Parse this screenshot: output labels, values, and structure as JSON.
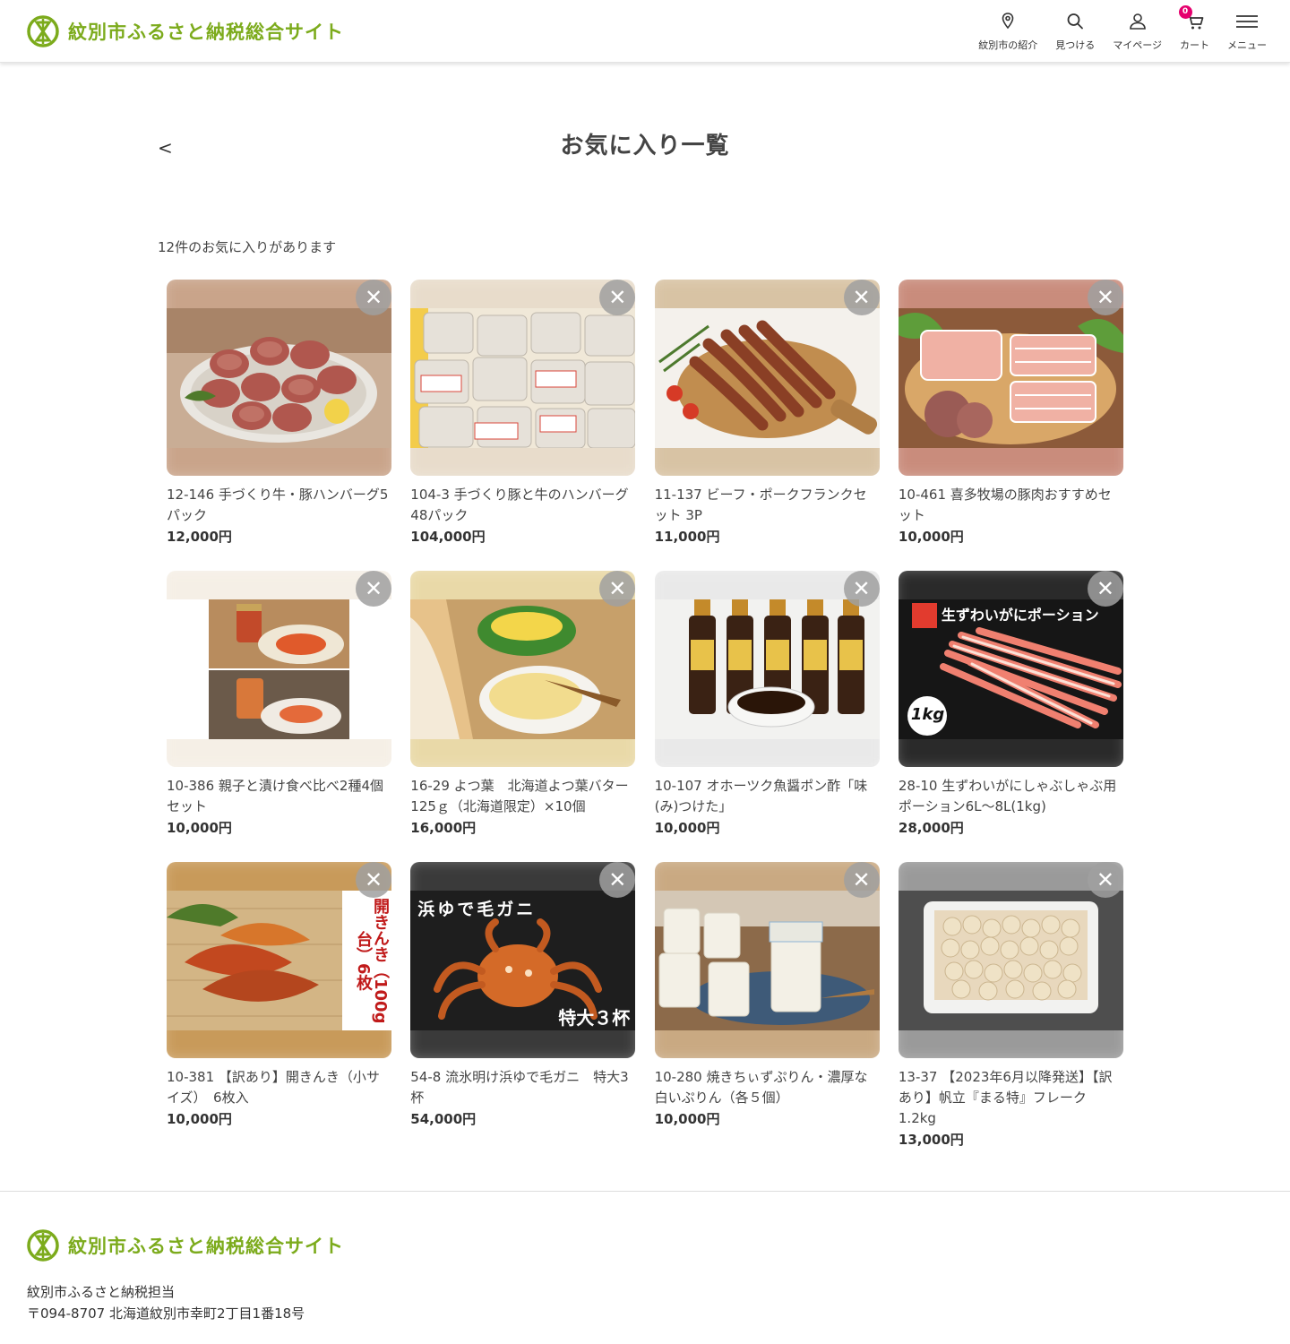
{
  "site": {
    "name": "紋別市ふるさと納税総合サイト"
  },
  "nav": {
    "items": [
      {
        "label": "紋別市の紹介",
        "icon": "map-pin-icon"
      },
      {
        "label": "見つける",
        "icon": "search-icon"
      },
      {
        "label": "マイページ",
        "icon": "user-icon"
      },
      {
        "label": "カート",
        "icon": "cart-icon",
        "badge": "0"
      },
      {
        "label": "メニュー",
        "icon": "menu-icon"
      }
    ]
  },
  "page": {
    "back": "<",
    "title": "お気に入り一覧",
    "count_text": "12件のお気に入りがあります"
  },
  "favorites": [
    {
      "name": "12-146 手づくり牛・豚ハンバーグ5パック",
      "price": "12,000円"
    },
    {
      "name": "104-3 手づくり豚と牛のハンバーグ 48パック",
      "price": "104,000円"
    },
    {
      "name": "11-137 ビーフ・ポークフランクセット 3P",
      "price": "11,000円"
    },
    {
      "name": "10-461 喜多牧場の豚肉おすすめセット",
      "price": "10,000円"
    },
    {
      "name": "10-386 親子と漬け食べ比べ2種4個セット",
      "price": "10,000円"
    },
    {
      "name": "16-29 よつ葉　北海道よつ葉バター125ｇ（北海道限定）×10個",
      "price": "16,000円"
    },
    {
      "name": "10-107 オホーツク魚醤ポン酢「味(み)つけた」",
      "price": "10,000円"
    },
    {
      "name": "28-10 生ずわいがにしゃぶしゃぶ用ポーション6L〜8L(1kg)",
      "price": "28,000円"
    },
    {
      "name": "10-381 【訳あり】開きんき（小サイズ）　6枚入",
      "price": "10,000円"
    },
    {
      "name": "54-8 流氷明け浜ゆで毛ガニ　特大3杯",
      "price": "54,000円"
    },
    {
      "name": "10-280 焼きちぃずぷりん・濃厚な白いぷりん（各５個）",
      "price": "10,000円"
    },
    {
      "name": "13-37 【2023年6月以降発送】【訳あり】帆立『まる特』フレーク 1.2kg",
      "price": "13,000円"
    }
  ],
  "image_text": {
    "crab_portion": "生ずわいがにポーション",
    "crab_portion_weight": "1kg",
    "kinki": "開きんき（100g台）6枚",
    "kegani_title": "浜ゆで毛ガニ",
    "kegani_badge": "特大３杯"
  },
  "remove_label": "✕",
  "footer": {
    "org": "紋別市ふるさと納税担当",
    "address": "〒094-8707 北海道紋別市幸町2丁目1番18号"
  },
  "colors": {
    "brand_green": "#7cab1c",
    "badge_pink": "#e5006e"
  }
}
